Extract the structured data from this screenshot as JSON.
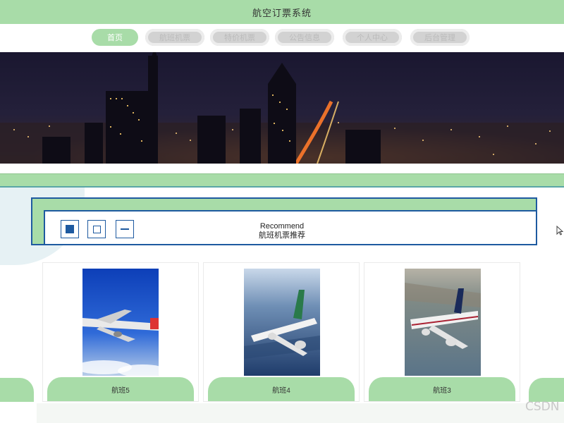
{
  "header": {
    "title": "航空订票系统"
  },
  "nav": {
    "items": [
      {
        "label": "首页",
        "active": true
      },
      {
        "label": "航班机票",
        "active": false
      },
      {
        "label": "特价机票",
        "active": false
      },
      {
        "label": "公告信息",
        "active": false
      },
      {
        "label": "个人中心",
        "active": false
      },
      {
        "label": "后台管理",
        "active": false
      }
    ]
  },
  "recommend": {
    "title_en": "Recommend",
    "title_cn": "航班机票推荐"
  },
  "cards": [
    {
      "label": "航班5"
    },
    {
      "label": "航班4"
    },
    {
      "label": "航班3"
    }
  ],
  "watermark": "CSDN",
  "colors": {
    "accent": "#a8dca8",
    "border_blue": "#1e5aa0"
  }
}
